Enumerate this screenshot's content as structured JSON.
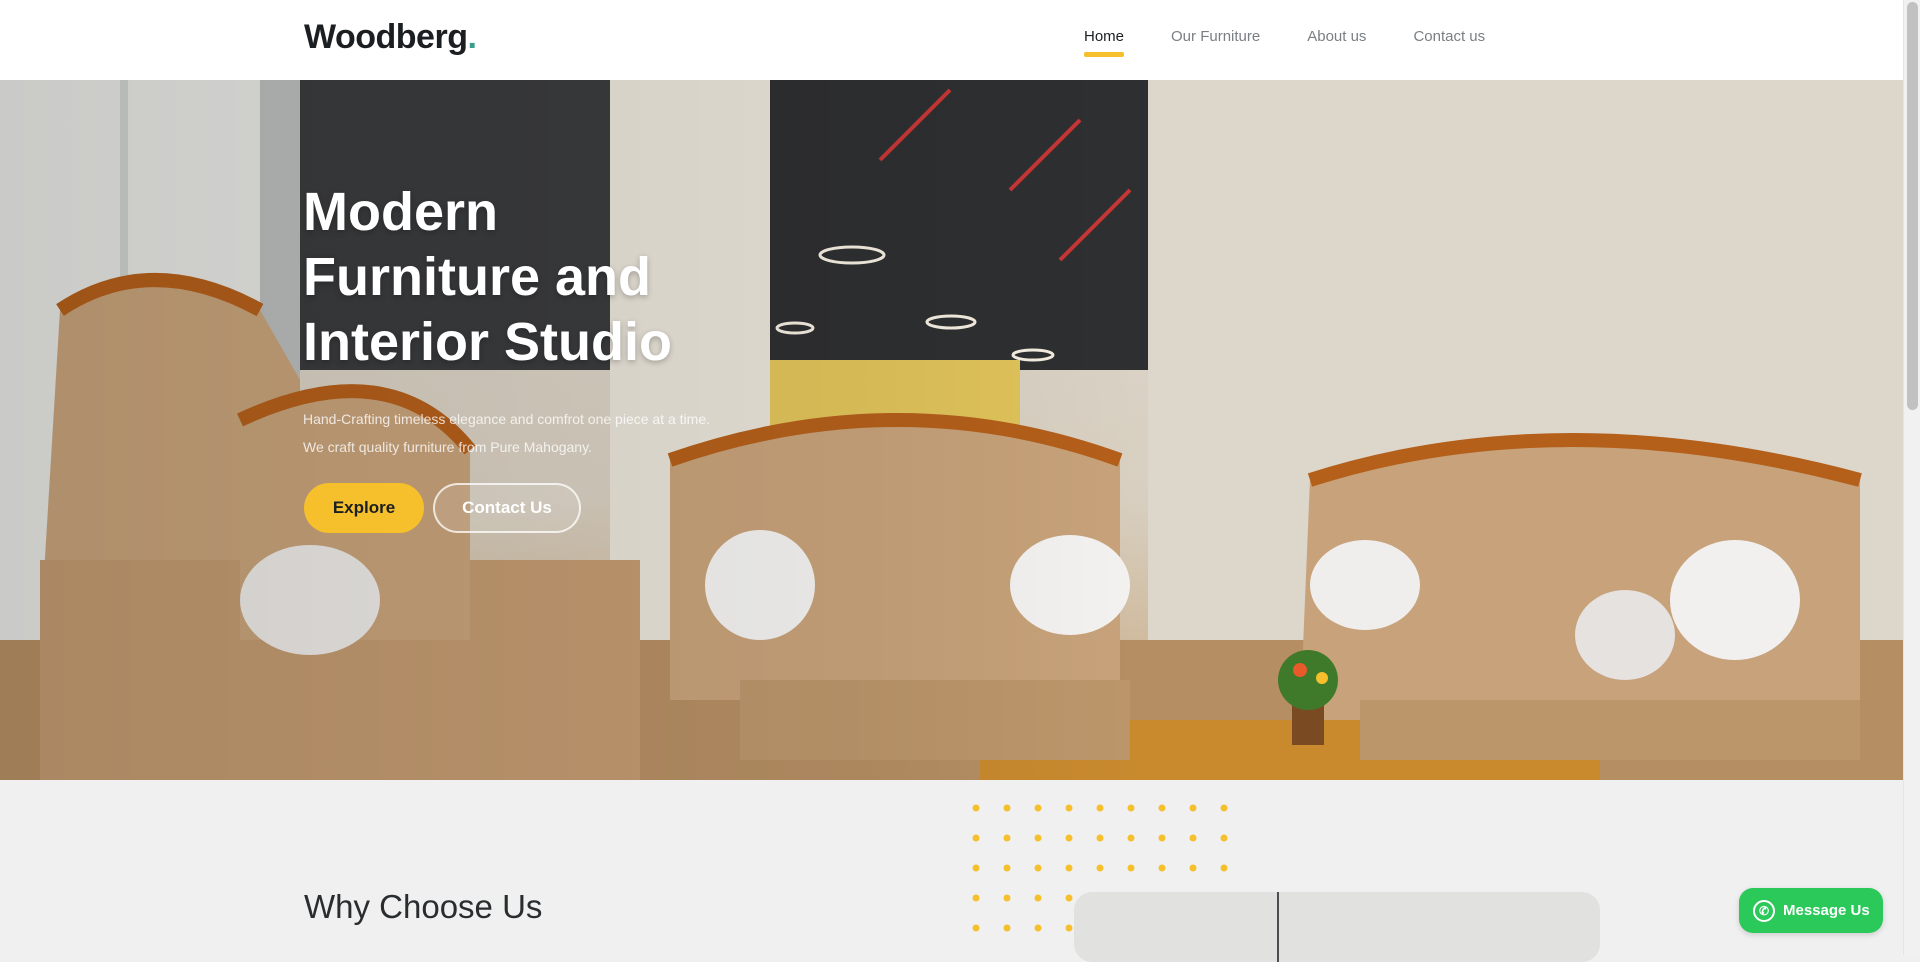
{
  "header": {
    "logo_text": "Woodberg",
    "logo_dot": ".",
    "nav": [
      {
        "label": "Home",
        "active": true
      },
      {
        "label": "Our Furniture",
        "active": false
      },
      {
        "label": "About us",
        "active": false
      },
      {
        "label": "Contact us",
        "active": false
      }
    ]
  },
  "hero": {
    "title_line1": "Modern",
    "title_line2": "Furniture and",
    "title_line3": "Interior Studio",
    "subtitle_line1": "Hand-Crafting timeless elegance and comfrot one piece at a time.",
    "subtitle_line2": "We craft quality furniture from Pure Mahogany.",
    "explore_label": "Explore",
    "contact_label": "Contact Us"
  },
  "section": {
    "why_title": "Why Choose Us"
  },
  "whatsapp": {
    "label": "Message Us",
    "icon": "whatsapp-icon"
  },
  "colors": {
    "accent": "#f5c02c",
    "whatsapp": "#2bc85a",
    "logo_dot": "#3a9e8f",
    "background": "#eff0ef"
  }
}
